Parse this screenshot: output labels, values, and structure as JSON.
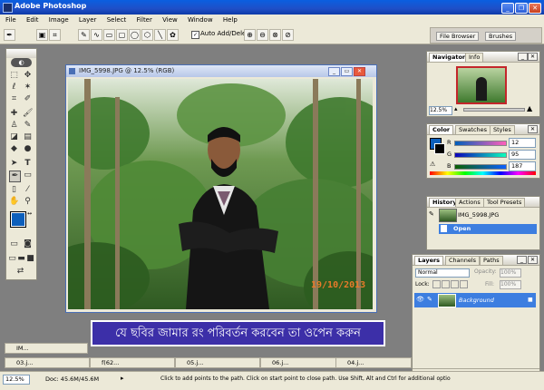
{
  "window": {
    "title": "Adobe Photoshop"
  },
  "menu": [
    "File",
    "Edit",
    "Image",
    "Layer",
    "Select",
    "Filter",
    "View",
    "Window",
    "Help"
  ],
  "options": {
    "auto_add_delete": "Auto Add/Delete"
  },
  "palette_well": {
    "file_browser": "File Browser",
    "brushes": "Brushes"
  },
  "document": {
    "title": "IMG_5998.JPG @ 12.5% (RGB)",
    "date_stamp": "19/10/2013"
  },
  "navigator": {
    "tabs": [
      "Navigator",
      "Info"
    ],
    "zoom": "12.5%"
  },
  "color": {
    "tabs": [
      "Color",
      "Swatches",
      "Styles"
    ],
    "r_label": "R",
    "g_label": "G",
    "b_label": "B",
    "r": "12",
    "g": "95",
    "b": "187"
  },
  "history": {
    "tabs": [
      "History",
      "Actions",
      "Tool Presets"
    ],
    "snapshot": "IMG_5998.JPG",
    "step": "Open"
  },
  "layers": {
    "tabs": [
      "Layers",
      "Channels",
      "Paths"
    ],
    "blend": "Normal",
    "opacity_label": "Opacity:",
    "opacity_value": "100%",
    "lock_label": "Lock:",
    "fill_label": "Fill:",
    "fill_value": "100%",
    "layer_name": "Background"
  },
  "caption": "যে ছবির জামার রং পরিবর্তন করবেন তা ওপেন করুন",
  "minimized": {
    "row1": [
      "IM..."
    ],
    "row2": [
      "03.j...",
      "f(62...",
      "05.j...",
      "06.j...",
      "04.j..."
    ]
  },
  "status": {
    "zoom": "12.5%",
    "doc": "Doc: 45.6M/45.6M",
    "hint": "Click to add points to the path.  Click on start point to close path.  Use Shift, Alt and Ctrl for additional optio"
  },
  "colors": {
    "foreground": "#0c5fbb",
    "accent": "#3c2fa8",
    "title_blue": "#2c5fd8",
    "layer_select": "#3d7ee0"
  }
}
